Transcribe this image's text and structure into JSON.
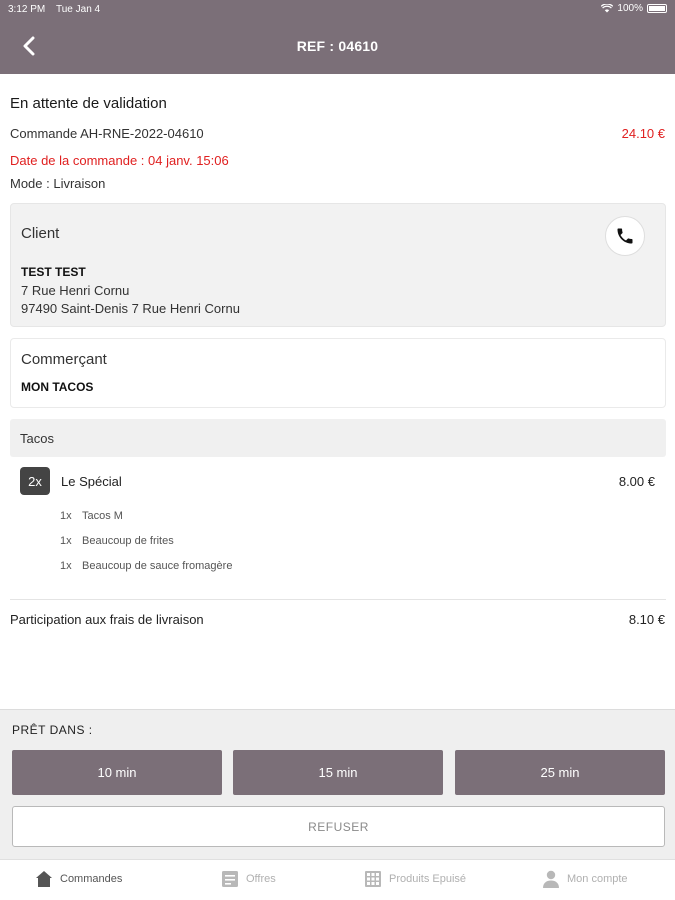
{
  "status_bar": {
    "time": "3:12 PM",
    "date": "Tue Jan 4",
    "battery": "100%"
  },
  "header": {
    "title": "REF : 04610"
  },
  "order": {
    "status": "En attente de validation",
    "number": "Commande AH-RNE-2022-04610",
    "total": "24.10 €",
    "date": "Date de la commande : 04 janv. 15:06",
    "mode": "Mode : Livraison"
  },
  "client": {
    "heading": "Client",
    "name": "TEST TEST",
    "address_line1": "7 Rue Henri Cornu",
    "address_line2": "97490 Saint-Denis 7 Rue Henri Cornu"
  },
  "merchant": {
    "heading": "Commerçant",
    "name": "MON TACOS"
  },
  "category": {
    "label": "Tacos"
  },
  "item": {
    "qty": "2x",
    "name": "Le Spécial",
    "price": "8.00 €",
    "options": [
      {
        "qty": "1x",
        "name": "Tacos M"
      },
      {
        "qty": "1x",
        "name": "Beaucoup de frites"
      },
      {
        "qty": "1x",
        "name": "Beaucoup de sauce fromagère"
      }
    ]
  },
  "delivery_fee": {
    "label": "Participation aux frais de livraison",
    "price": "8.10 €"
  },
  "ready": {
    "label": "PRÊT DANS :",
    "options": [
      "10 min",
      "15 min",
      "25 min"
    ],
    "refuse": "REFUSER"
  },
  "tabs": [
    {
      "label": "Commandes",
      "icon": "home-icon",
      "active": true
    },
    {
      "label": "Offres",
      "icon": "offers-icon",
      "active": false
    },
    {
      "label": "Produits Epuisé",
      "icon": "grid-icon",
      "active": false
    },
    {
      "label": "Mon compte",
      "icon": "user-icon",
      "active": false
    }
  ],
  "colors": {
    "header": "#7b6f78",
    "alert": "#e02020",
    "button": "#7b6f78"
  }
}
